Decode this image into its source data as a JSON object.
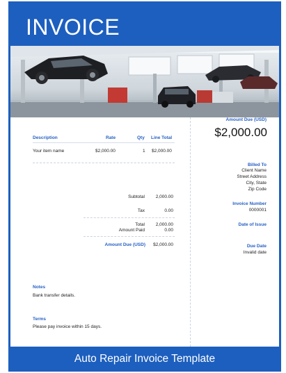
{
  "invoice": {
    "title": "INVOICE",
    "table": {
      "headers": [
        "Description",
        "Rate",
        "Qty",
        "Line Total"
      ],
      "rows": [
        {
          "description": "Your item name",
          "rate": "$2,000.00",
          "qty": "1",
          "line_total": "$2,000.00"
        }
      ]
    },
    "totals": {
      "subtotal_label": "Subtotal",
      "subtotal_value": "2,000.00",
      "tax_label": "Tax",
      "tax_value": "0.00",
      "total_label": "Total",
      "total_value": "2,000.00",
      "amount_paid_label": "Amount Paid",
      "amount_paid_value": "0.00",
      "amount_due_label": "Amount Due (USD)",
      "amount_due_value": "$2,000.00"
    },
    "notes": {
      "label": "Notes",
      "text": "Bank transfer details."
    },
    "terms": {
      "label": "Terms",
      "text": "Please pay invoice within 15 days."
    },
    "sidebar": {
      "amount_due_label": "Amount Due (USD)",
      "amount_due_value": "$2,000.00",
      "billed_to_label": "Billed To",
      "billed_to_lines": [
        "Client Name",
        "Street Address",
        "City, State",
        "Zip Code"
      ],
      "invoice_number_label": "Invoice Number",
      "invoice_number_value": "0000001",
      "date_of_issue_label": "Date of Issue",
      "due_date_label": "Due Date",
      "due_date_value": "Invalid date"
    }
  },
  "footer": {
    "caption": "Auto Repair Invoice Template"
  },
  "colors": {
    "brand_blue": "#1d5fbf",
    "label_blue": "#2660c4"
  }
}
